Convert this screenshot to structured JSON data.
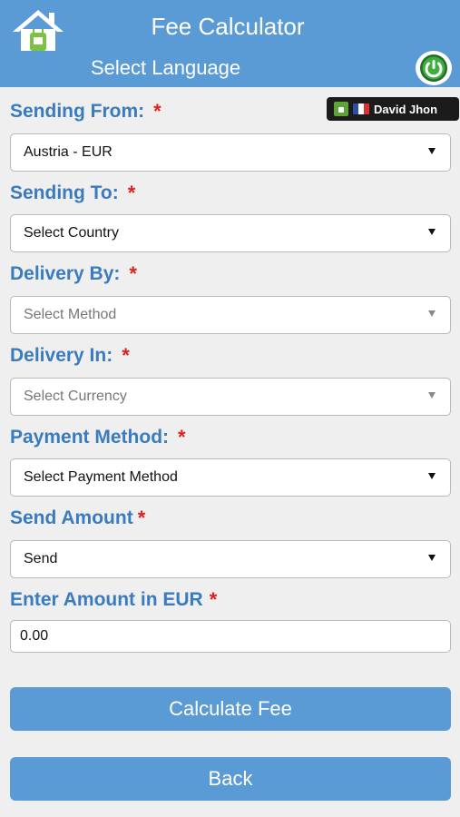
{
  "header": {
    "title": "Fee Calculator",
    "language_link": "Select Language"
  },
  "user_badge": {
    "name": "David Jhon"
  },
  "form": {
    "fields": [
      {
        "label": "Sending From:",
        "value": "Austria - EUR"
      },
      {
        "label": "Sending To:",
        "value": "Select Country"
      },
      {
        "label": "Delivery By:",
        "value": "Select Method"
      },
      {
        "label": "Delivery In:",
        "value": "Select Currency"
      },
      {
        "label": "Payment Method:",
        "value": "Select Payment Method"
      },
      {
        "label": "Send Amount",
        "value": "Send"
      },
      {
        "label": "Enter Amount in EUR",
        "value": "0.00"
      }
    ],
    "required_mark": "*"
  },
  "buttons": {
    "calculate": "Calculate Fee",
    "back": "Back"
  },
  "colors": {
    "header_bg": "#5b9bd5",
    "label_blue": "#3a7bbf",
    "required_red": "#e0201b",
    "page_bg": "#efefef"
  },
  "icons": [
    "home-icon",
    "power-icon",
    "android-icon",
    "france-flag-icon",
    "dropdown-caret-icon"
  ]
}
